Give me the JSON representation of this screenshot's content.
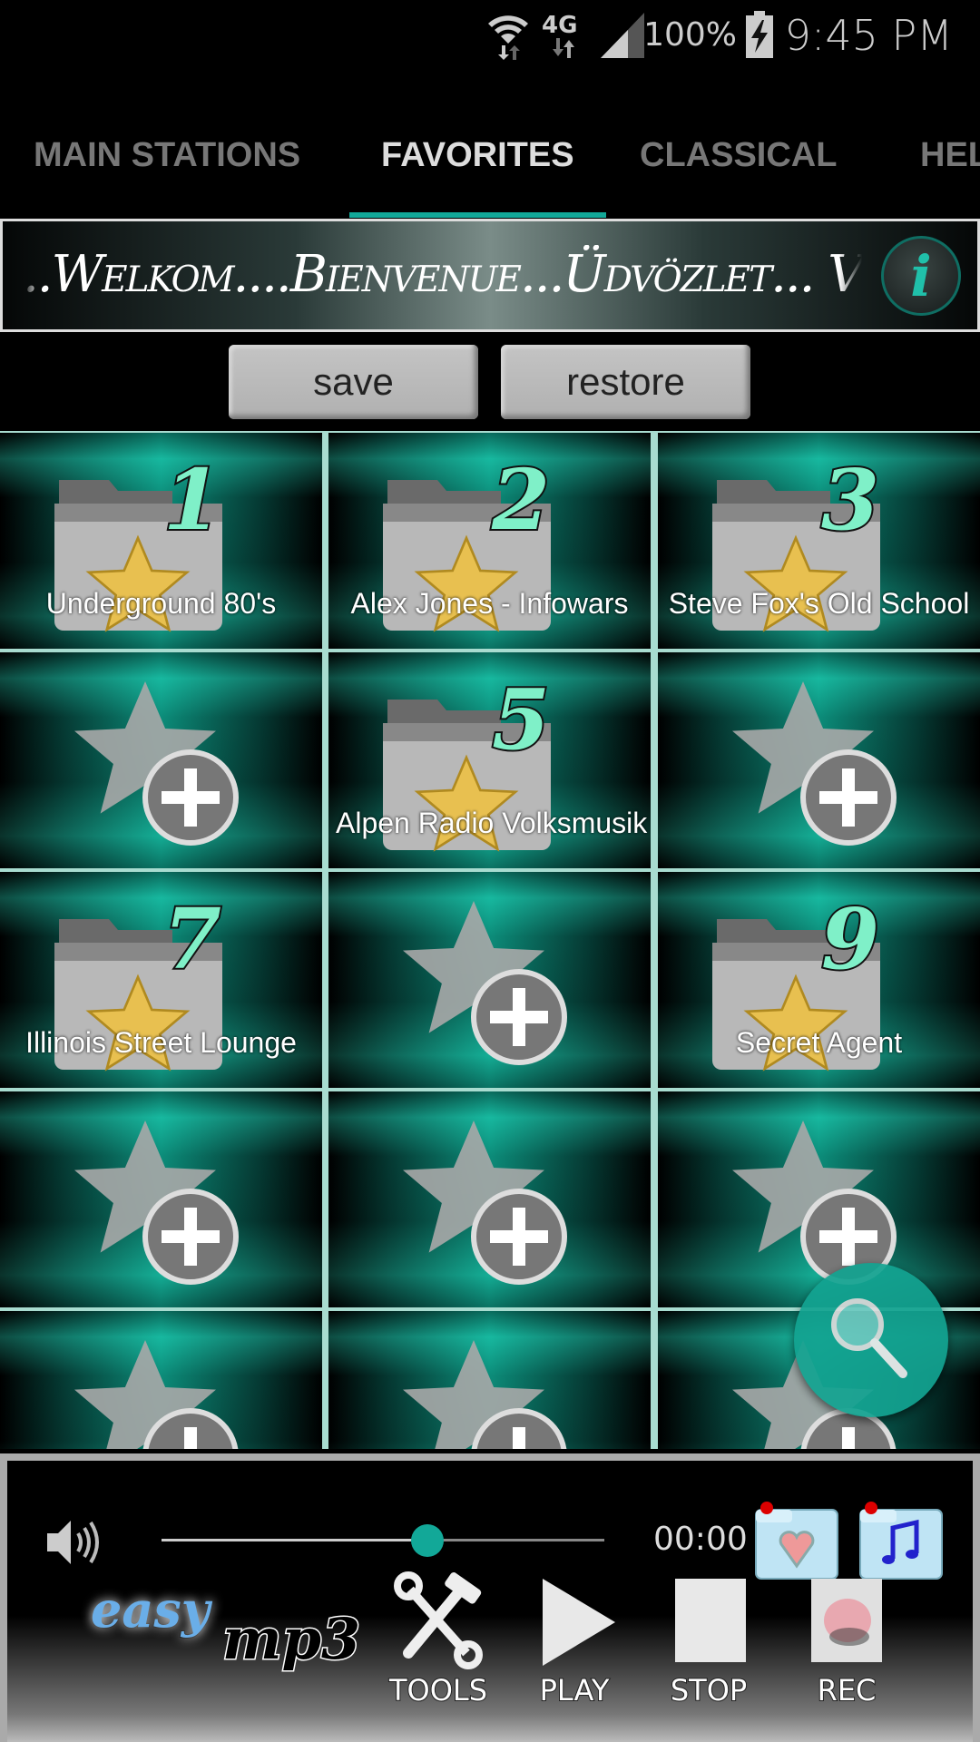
{
  "status_bar": {
    "battery": "100%",
    "time": "9:45 PM",
    "icons": [
      "wifi-icon",
      "4g-lte-icon",
      "signal-icon",
      "battery-charging-icon"
    ]
  },
  "tabs": [
    {
      "label": "MAIN STATIONS",
      "active": false
    },
    {
      "label": "FAVORITES",
      "active": true
    },
    {
      "label": "CLASSICAL",
      "active": false
    },
    {
      "label": "HEL",
      "active": false
    }
  ],
  "banner": {
    "text": "..Welkom....Bienvenue...Üdvözlet... Velkomi",
    "info_icon": "i"
  },
  "actions": {
    "save": "save",
    "restore": "restore"
  },
  "favorites": [
    {
      "number": "1",
      "name": "Underground 80's"
    },
    {
      "number": "2",
      "name": "Alex Jones - Infowars"
    },
    {
      "number": "3",
      "name": "Steve Fox's Old School"
    },
    {
      "number": null,
      "name": null
    },
    {
      "number": "5",
      "name": "Alpen Radio Volksmusik"
    },
    {
      "number": null,
      "name": null
    },
    {
      "number": "7",
      "name": "Illinois Street Lounge"
    },
    {
      "number": null,
      "name": null
    },
    {
      "number": "9",
      "name": "Secret Agent"
    },
    {
      "number": null,
      "name": null
    },
    {
      "number": null,
      "name": null
    },
    {
      "number": null,
      "name": null
    },
    {
      "number": null,
      "name": null
    },
    {
      "number": null,
      "name": null
    },
    {
      "number": null,
      "name": null
    }
  ],
  "player": {
    "volume_fraction": 0.6,
    "time": "00:00",
    "controls": {
      "tools": "TOOLS",
      "play": "PLAY",
      "stop": "STOP",
      "rec": "REC"
    },
    "logo": "easy mp3"
  },
  "colors": {
    "accent": "#12a898",
    "tile": "#0ea58f",
    "number": "#7ff0c8"
  }
}
